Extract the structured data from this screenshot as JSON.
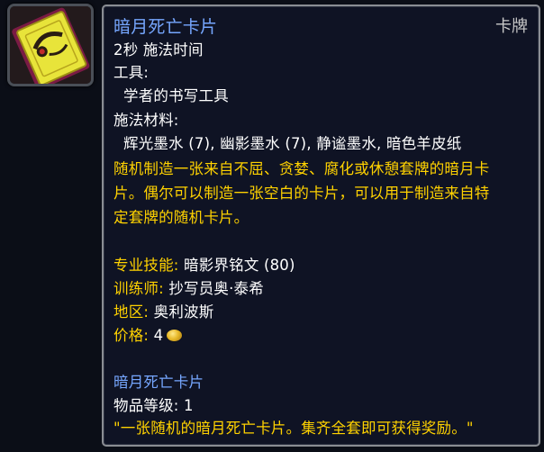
{
  "item": {
    "title": "暗月死亡卡片",
    "type_label": "卡牌",
    "cast_time": "2秒 施法时间",
    "tools_label": "工具:",
    "tool_name": "学者的书写工具",
    "reagents_label": "施法材料:",
    "reagents": "辉光墨水 (7), 幽影墨水 (7), 静谧墨水, 暗色羊皮纸",
    "description_lines": [
      "随机制造一张来自不屈、贪婪、腐化或休憩套牌的暗月卡",
      "片。偶尔可以制造一张空白的卡片，可以用于制造来自特",
      "定套牌的随机卡片。"
    ],
    "skill": {
      "label": "专业技能:",
      "value": "暗影界铭文 (80)"
    },
    "trainer": {
      "label": "训练师:",
      "value": "抄写员奥·泰希"
    },
    "zone": {
      "label": "地区:",
      "value": "奥利波斯"
    },
    "price": {
      "label": "价格:",
      "value": "4",
      "icon": "gold-coin-icon"
    },
    "result_name": "暗月死亡卡片",
    "item_level": "物品等级: 1",
    "flavor": "\"一张随机的暗月死亡卡片。集齐全套即可获得奖励。\""
  },
  "icon": {
    "name": "darkmoon-card-icon"
  },
  "colors": {
    "title": "#76a7ff",
    "gold_text": "#ffd200",
    "white_text": "#ffffff",
    "tooltip_bg": "#0f1324",
    "border": "#8a8d93"
  }
}
